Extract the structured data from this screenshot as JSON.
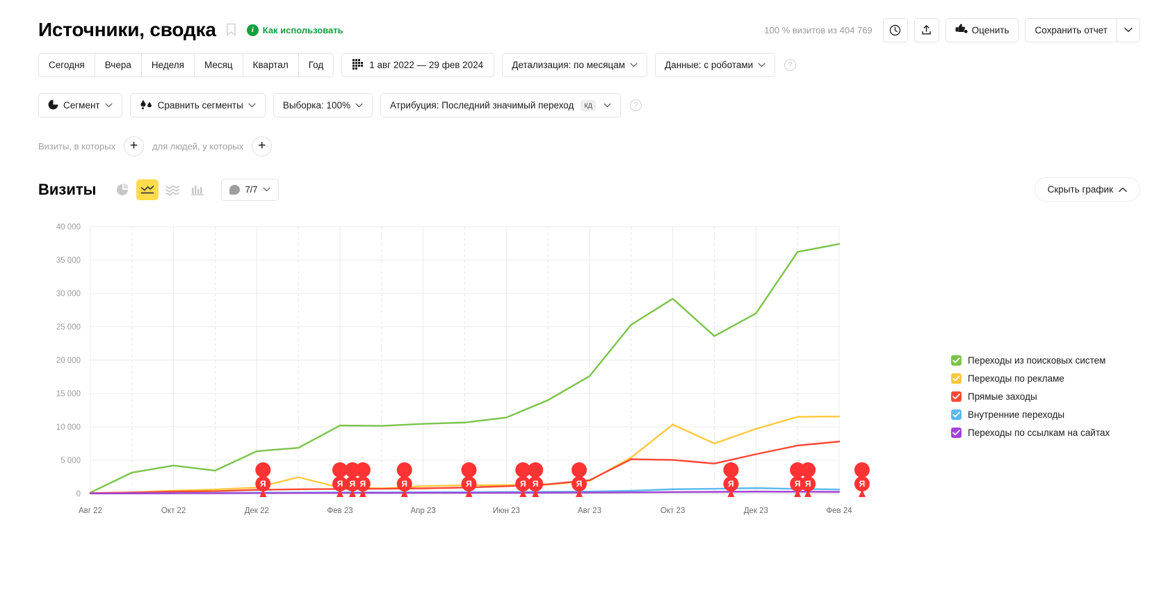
{
  "header": {
    "title": "Источники, сводка",
    "bookmark_icon": "bookmark-icon",
    "howto_label": "Как использовать",
    "info_badge": "i",
    "visits_count": "100 % визитов из 404 769",
    "clock_icon": "clock-icon",
    "export_icon": "export-icon",
    "rate_label": "Оценить",
    "rate_icon": "thumbs-icon",
    "save_report_label": "Сохранить отчет",
    "save_caret": "⌄"
  },
  "periods": {
    "items": [
      "Сегодня",
      "Вчера",
      "Неделя",
      "Месяц",
      "Квартал",
      "Год"
    ],
    "date_range": "1 авг 2022 — 29 фев 2024",
    "calendar_icon": "calendar-icon",
    "detail_label": "Детализация: по месяцам",
    "data_label": "Данные: с роботами",
    "help_icon": "help-icon",
    "caret": "⌄"
  },
  "segments": {
    "segment_label": "Сегмент",
    "segment_icon": "pie-icon",
    "compare_label": "Сравнить сегменты",
    "compare_icon": "compare-icon",
    "sample_label": "Выборка: 100%",
    "attribution_label": "Атрибуция: Последний значимый переход",
    "attribution_badge": "кд",
    "help_icon": "help-icon",
    "caret": "⌄"
  },
  "visit_filter": {
    "visits_label": "Визиты, в которых",
    "people_label": "для людей, у которых",
    "plus": "+"
  },
  "chart_toolbar": {
    "metric_label": "Визиты",
    "view_pie": "pie-chart-icon",
    "view_line": "line-chart-icon",
    "view_area": "area-chart-icon",
    "view_bar": "bar-chart-icon",
    "annotations_label": "7/7",
    "annotation_icon": "comment-icon",
    "caret": "⌄",
    "hide_chart_label": "Скрыть график",
    "hide_caret": "⌃",
    "active_view": "line"
  },
  "legend": {
    "items": [
      {
        "label": "Переходы из поисковых систем",
        "color": "#7cc34a",
        "checked": true
      },
      {
        "label": "Переходы по рекламе",
        "color": "#ffc93e",
        "checked": true
      },
      {
        "label": "Прямые заходы",
        "color": "#fc4734",
        "checked": true
      },
      {
        "label": "Внутренние переходы",
        "color": "#5bb8f0",
        "checked": true
      },
      {
        "label": "Переходы по ссылкам на сайтах",
        "color": "#a342d6",
        "checked": true
      }
    ]
  },
  "chart_data": {
    "type": "line",
    "title": "Визиты",
    "xlabel": "",
    "ylabel": "",
    "ylim": [
      0,
      40000
    ],
    "yticks": [
      0,
      5000,
      10000,
      15000,
      20000,
      25000,
      30000,
      35000,
      40000
    ],
    "ytick_labels": [
      "0",
      "5 000",
      "10 000",
      "15 000",
      "20 000",
      "25 000",
      "30 000",
      "35 000",
      "40 000"
    ],
    "grid": true,
    "legend_position": "right",
    "x": [
      "Авг 22",
      "Сен 22",
      "Окт 22",
      "Ноя 22",
      "Дек 22",
      "Янв 23",
      "Фев 23",
      "Мар 23",
      "Апр 23",
      "Май 23",
      "Июн 23",
      "Июл 23",
      "Авг 23",
      "Сен 23",
      "Окт 23",
      "Ноя 23",
      "Дек 23",
      "Янв 24",
      "Фев 24"
    ],
    "xtick_labels": [
      "Авг 22",
      "Окт 22",
      "Дек 22",
      "Фев 23",
      "Апр 23",
      "Июн 23",
      "Авг 23",
      "Окт 23",
      "Дек 23",
      "Фев 24"
    ],
    "series": [
      {
        "name": "Переходы из поисковых систем",
        "color": "#7cc34a",
        "values": [
          150,
          3150,
          4200,
          3450,
          6350,
          6850,
          10200,
          10150,
          10450,
          10650,
          11400,
          14000,
          17600,
          25300,
          29200,
          23600,
          27000,
          36200,
          37400
        ]
      },
      {
        "name": "Переходы по рекламе",
        "color": "#ffc93e",
        "values": [
          60,
          180,
          430,
          620,
          900,
          2450,
          900,
          780,
          1120,
          1250,
          1280,
          1350,
          1900,
          5400,
          10350,
          7500,
          9700,
          11500,
          11550
        ]
      },
      {
        "name": "Прямые заходы",
        "color": "#fc4734",
        "values": [
          70,
          160,
          300,
          360,
          560,
          640,
          700,
          720,
          780,
          900,
          1100,
          1400,
          2000,
          5150,
          5050,
          4500,
          5900,
          7200,
          7800
        ]
      },
      {
        "name": "Внутренние переходы",
        "color": "#5bb8f0",
        "values": [
          20,
          40,
          70,
          90,
          130,
          160,
          180,
          180,
          200,
          220,
          240,
          260,
          300,
          420,
          650,
          720,
          820,
          700,
          620
        ]
      },
      {
        "name": "Переходы по ссылкам на сайтах",
        "color": "#a342d6",
        "values": [
          15,
          25,
          40,
          50,
          70,
          85,
          95,
          100,
          110,
          115,
          125,
          135,
          150,
          190,
          230,
          260,
          300,
          280,
          260
        ]
      }
    ],
    "annotation_markers": {
      "icon": "yandex-marker-icon",
      "label": "Я",
      "positions": [
        4.15,
        6.0,
        6.3,
        6.55,
        7.55,
        9.1,
        10.4,
        10.7,
        11.75,
        15.4,
        17.0,
        17.25,
        18.55
      ]
    }
  }
}
